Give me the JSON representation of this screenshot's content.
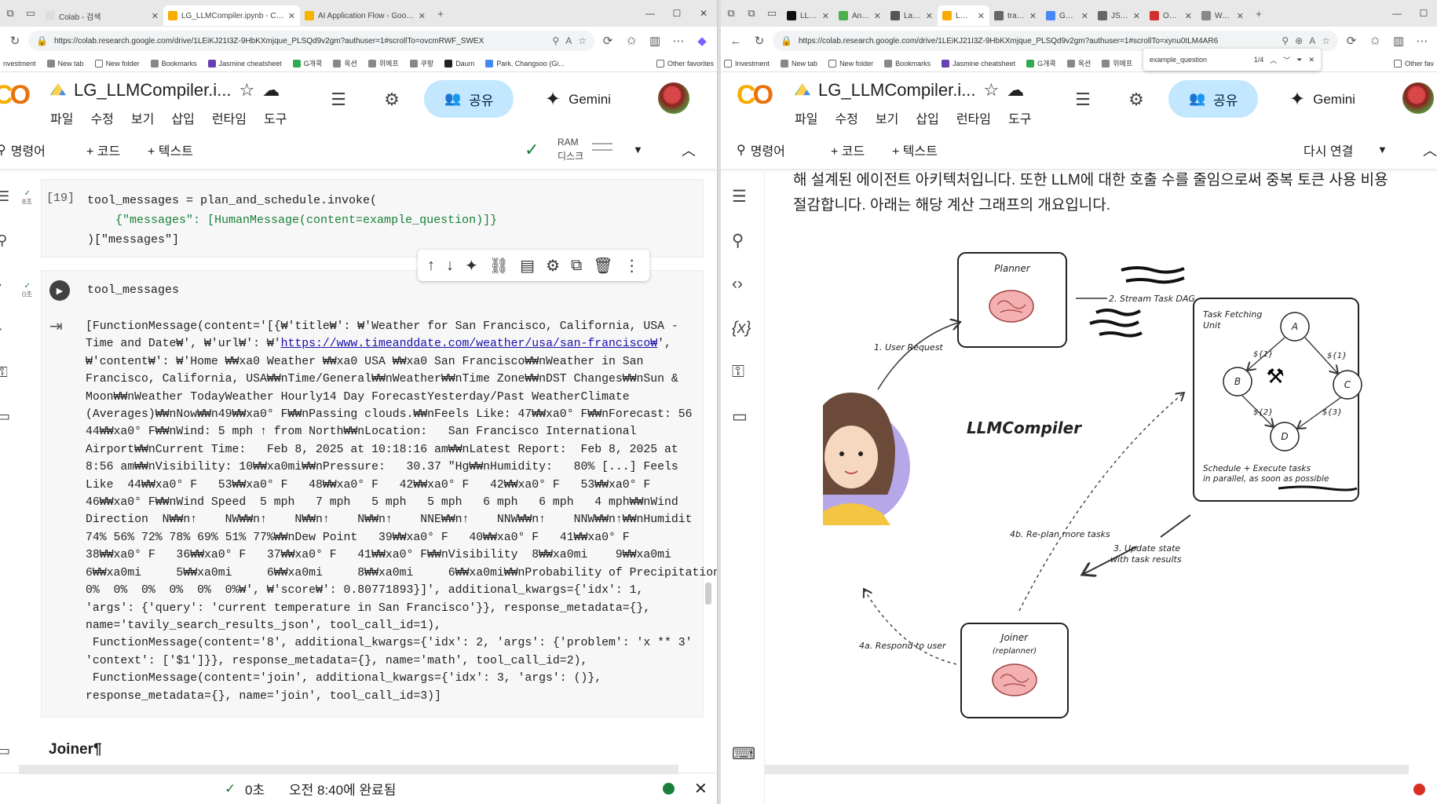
{
  "left": {
    "tabs": [
      {
        "title": "Colab - 검색",
        "color": "#f9ab00"
      },
      {
        "title": "LG_LLMCompiler.ipynb - Colab",
        "color": "#f9ab00",
        "active": true
      },
      {
        "title": "AI Application Flow - Google Slides",
        "color": "#f4b400"
      }
    ],
    "url": "https://colab.research.google.com/drive/1LEiKJ21I3Z-9HbKXmjque_PLSQd9v2gm?authuser=1#scrollTo=ovcmRWF_SWEX",
    "bookmarks": [
      "nvestment",
      "New tab",
      "New folder",
      "Bookmarks",
      "Jasmine cheatsheet",
      "G개쿡",
      "옥션",
      "위메프",
      "쿠팡",
      "Daum",
      "Park, Changsoo (Gi...",
      "Other favorites"
    ],
    "doc_title": "LG_LLMCompiler.i...",
    "menu": [
      "파일",
      "수정",
      "보기",
      "삽입",
      "런타임",
      "도구"
    ],
    "share_label": "공유",
    "gemini_label": "Gemini",
    "toolbar": {
      "command": "명령어",
      "code": "+ 코드",
      "text": "+ 텍스트",
      "ram": "RAM",
      "disk": "디스크"
    },
    "cell1": {
      "exec": "[19]",
      "time": "8초",
      "lines": [
        "tool_messages = plan_and_schedule.invoke(",
        "    {\"messages\": [HumanMessage(content=example_question)]}",
        ")[\"messages\"]"
      ]
    },
    "cell2": {
      "time": "0초",
      "code": "tool_messages"
    },
    "output": {
      "line1": "[FunctionMessage(content='[{₩'title₩': ₩'Weather for San Francisco, California, USA -",
      "line2_pre": "Time and Date₩', ₩'url₩': ₩'",
      "link": "https://www.timeanddate.com/weather/usa/san-francisco₩",
      "line2_post": "',",
      "lines": [
        "₩'content₩': ₩'Home ₩₩xa0 Weather ₩₩xa0 USA ₩₩xa0 San Francisco₩₩nWeather in San",
        "Francisco, California, USA₩₩nTime/General₩₩nWeather₩₩nTime Zone₩₩nDST Changes₩₩nSun &",
        "Moon₩₩nWeather TodayWeather Hourly14 Day ForecastYesterday/Past WeatherClimate",
        "(Averages)₩₩nNow₩₩n49₩₩xa0° F₩₩nPassing clouds.₩₩nFeels Like: 47₩₩xa0° F₩₩nForecast: 56",
        "44₩₩xa0° F₩₩nWind: 5 mph ↑ from North₩₩nLocation:   San Francisco International",
        "Airport₩₩nCurrent Time:   Feb 8, 2025 at 10:18:16 am₩₩nLatest Report:  Feb 8, 2025 at",
        "8:56 am₩₩nVisibility: 10₩₩xa0mi₩₩nPressure:   30.37 \"Hg₩₩nHumidity:   80% [...] Feels",
        "Like  44₩₩xa0° F   53₩₩xa0° F   48₩₩xa0° F   42₩₩xa0° F   42₩₩xa0° F   53₩₩xa0° F",
        "46₩₩xa0° F₩₩nWind Speed  5 mph   7 mph   5 mph   5 mph   6 mph   6 mph   4 mph₩₩nWind",
        "Direction  N₩₩n↑    NW₩₩n↑    N₩₩n↑    N₩₩n↑    NNE₩₩n↑    NNW₩₩n↑    NNW₩₩n↑₩₩nHumidit",
        "74% 56% 72% 78% 69% 51% 77%₩₩nDew Point   39₩₩xa0° F   40₩₩xa0° F   41₩₩xa0° F",
        "38₩₩xa0° F   36₩₩xa0° F   37₩₩xa0° F   41₩₩xa0° F₩₩nVisibility  8₩₩xa0mi    9₩₩xa0mi",
        "6₩₩xa0mi     5₩₩xa0mi     6₩₩xa0mi     8₩₩xa0mi     6₩₩xa0mi₩₩nProbability of Precipitation",
        "0%  0%  0%  0%  0%  0%₩', ₩'score₩': 0.80771893}]', additional_kwargs={'idx': 1,",
        "'args': {'query': 'current temperature in San Francisco'}}, response_metadata={},",
        "name='tavily_search_results_json', tool_call_id=1),",
        " FunctionMessage(content='8', additional_kwargs={'idx': 2, 'args': {'problem': 'x ** 3'",
        "'context': ['$1']}}, response_metadata={}, name='math', tool_call_id=2),",
        " FunctionMessage(content='join', additional_kwargs={'idx': 3, 'args': ()},",
        "response_metadata={}, name='join', tool_call_id=3)]"
      ]
    },
    "heading": "Joiner¶",
    "status": {
      "time": "0초",
      "completed": "오전 8:40에 완료됨"
    }
  },
  "right": {
    "tabs": [
      "LLMCo",
      "An LLM",
      "LangSm",
      "LG_LLM",
      "translat",
      "Google",
      "JSON V",
      "Online",
      "Weathe"
    ],
    "url": "https://colab.research.google.com/drive/1LEiKJ21I3Z-9HbKXmjque_PLSQd9v2gm?authuser=1#scrollTo=xynu0tLM4AR6",
    "bookmarks": [
      "Investment",
      "New tab",
      "New folder",
      "Bookmarks",
      "Jasmine cheatsheet",
      "G개쿡",
      "옥션",
      "위메프",
      "Other fav"
    ],
    "find": {
      "query": "example_question",
      "count": "1/4"
    },
    "doc_title": "LG_LLMCompiler.i...",
    "menu": [
      "파일",
      "수정",
      "보기",
      "삽입",
      "런타임",
      "도구"
    ],
    "share_label": "공유",
    "gemini_label": "Gemini",
    "toolbar": {
      "command": "명령어",
      "code": "+ 코드",
      "text": "+ 텍스트",
      "reconnect": "다시 연결"
    },
    "text_lines": [
      "해 설계된 에이전트 아키텍처입니다. 또한 LLM에 대한 호출 수를 줄임으로써 중복 토큰 사용 비용",
      "절감합니다. 아래는 해당 계산 그래프의 개요입니다."
    ],
    "diagram": {
      "planner": "Planner",
      "stream": "2. Stream Task DAG",
      "user_request": "1. User Request",
      "title": "LLMCompiler",
      "task_unit_1": "Task Fetching",
      "task_unit_2": "Unit",
      "nodes": [
        "A",
        "B",
        "C",
        "D"
      ],
      "deps": [
        "${1}",
        "${1}",
        "${2}",
        "${3}"
      ],
      "schedule_1": "Schedule + Execute tasks",
      "schedule_2": "in parallel, as soon as possible",
      "replan": "4b. Re-plan more tasks",
      "update_1": "3. Update state",
      "update_2": "with task results",
      "respond": "4a. Respond to user",
      "joiner": "Joiner",
      "replanner": "(replanner)"
    }
  }
}
